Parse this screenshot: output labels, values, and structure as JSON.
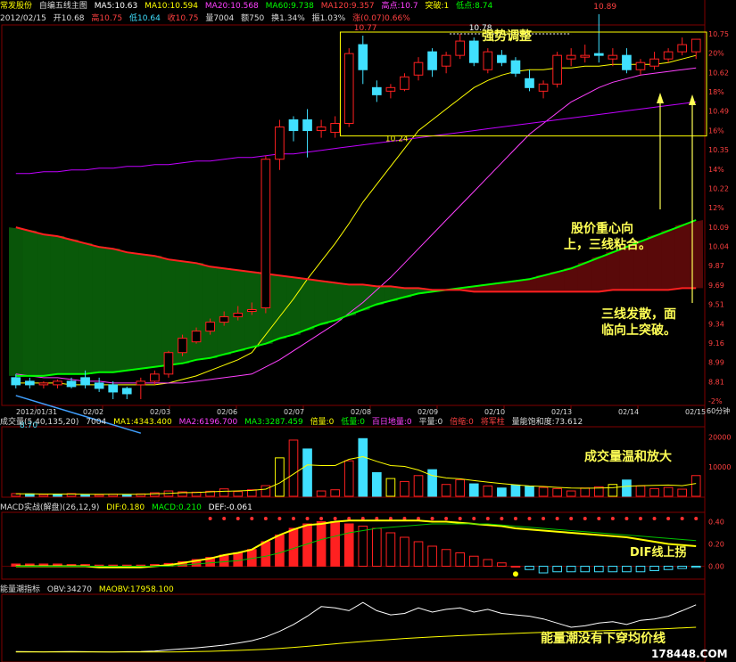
{
  "header": {
    "stock_name": "常发股份",
    "indicator_name": "自编五线主图",
    "ma5": "MA5:10.63",
    "ma10": "MA10:10.594",
    "ma20": "MA20:10.568",
    "ma60": "MA60:9.738",
    "ma120": "MA120:9.357",
    "high_point": "高点:10.7",
    "breakout": "突破:1",
    "low_point": "低点:8.74",
    "date": "2012/02/15",
    "open": "开10.68",
    "high": "高10.75",
    "low": "低10.64",
    "close": "收10.75",
    "volume": "量7004",
    "amount": "额750",
    "turnover": "换1.34%",
    "amplitude": "振1.03%",
    "change": "涨(0.07)0.66%"
  },
  "annotations": {
    "title": "强势调整",
    "gravity": [
      "股价重心向",
      "上，三线粘合。"
    ],
    "diverge": [
      "三线发散，面",
      "临向上突破。"
    ],
    "volume_note": "成交量温和放大",
    "dif_note": "DIF线上拐",
    "obv_note": "能量潮没有下穿均价线",
    "label_1077": "10.77",
    "label_1078": "10.78",
    "label_1089": "10.89",
    "label_1024": "10.24",
    "label_870": "8.70"
  },
  "price_axis": [
    "10.75",
    "20%",
    "10.62",
    "18%",
    "10.49",
    "16%",
    "10.35",
    "14%",
    "10.22",
    "12%",
    "10.09",
    "10.04",
    "9.87",
    "9.69",
    "9.51",
    "9.34",
    "9.16",
    "8.99",
    "8.81",
    "-2%"
  ],
  "date_axis": [
    "2012/01/31",
    "02/02",
    "02/03",
    "02/06",
    "02/07",
    "02/08",
    "02/09",
    "02/10",
    "02/13",
    "02/14",
    "02/15"
  ],
  "timeframe": "60分钟",
  "volume_header": {
    "name": "成交量(5,40,135,20)",
    "v": "7004",
    "ma1": "MA1:4343.400",
    "ma2": "MA2:6196.700",
    "ma3": "MA3:3287.459",
    "bei": "倍量:0",
    "di": "低量:0",
    "bairi": "百日地量:0",
    "ping": "平量:0",
    "beisuo": "倍缩:0",
    "jiangjun": "将军柱",
    "baohe": "量能饱和度:73.612"
  },
  "volume_axis": [
    "20000",
    "10000"
  ],
  "macd_header": {
    "name": "MACD实战(解盘)(26,12,9)",
    "dif": "DIF:0.180",
    "macd": "MACD:0.210",
    "dea": "DEF:-0.061"
  },
  "macd_axis": [
    "0.40",
    "0.20",
    "0.00"
  ],
  "obv_header": {
    "name": "能量潮指标",
    "obv": "OBV:34270",
    "maobv": "MAOBV:17958.100"
  },
  "watermark": "178448.COM",
  "colors": {
    "up": "#ff2020",
    "down": "#40e0ff",
    "ma5": "#ffffff",
    "ma10": "#ffff00",
    "ma20": "#ff40ff",
    "ma60": "#00ff00",
    "ma120": "#ff2020",
    "ma_long": "#c000ff"
  },
  "chart_data": [
    {
      "type": "candlestick",
      "title": "",
      "ylim": [
        8.72,
        10.82
      ],
      "annotations_price": {
        "high1": 10.77,
        "high2": 10.78,
        "high3": 10.89,
        "low1": 10.24,
        "low2": 8.7
      },
      "candles": [
        {
          "o": 8.86,
          "h": 8.88,
          "l": 8.8,
          "c": 8.82
        },
        {
          "o": 8.84,
          "h": 8.86,
          "l": 8.8,
          "c": 8.82
        },
        {
          "o": 8.82,
          "h": 8.84,
          "l": 8.8,
          "c": 8.83
        },
        {
          "o": 8.82,
          "h": 8.85,
          "l": 8.8,
          "c": 8.84
        },
        {
          "o": 8.84,
          "h": 8.86,
          "l": 8.8,
          "c": 8.81
        },
        {
          "o": 8.86,
          "h": 8.9,
          "l": 8.8,
          "c": 8.82
        },
        {
          "o": 8.83,
          "h": 8.86,
          "l": 8.78,
          "c": 8.8
        },
        {
          "o": 8.82,
          "h": 8.84,
          "l": 8.74,
          "c": 8.78
        },
        {
          "o": 8.8,
          "h": 8.81,
          "l": 8.74,
          "c": 8.77
        },
        {
          "o": 8.82,
          "h": 8.86,
          "l": 8.74,
          "c": 8.84
        },
        {
          "o": 8.84,
          "h": 8.9,
          "l": 8.82,
          "c": 8.88
        },
        {
          "o": 8.88,
          "h": 9.01,
          "l": 8.86,
          "c": 9.0
        },
        {
          "o": 9.0,
          "h": 9.1,
          "l": 8.98,
          "c": 9.08
        },
        {
          "o": 9.06,
          "h": 9.14,
          "l": 9.05,
          "c": 9.12
        },
        {
          "o": 9.12,
          "h": 9.19,
          "l": 9.1,
          "c": 9.17
        },
        {
          "o": 9.17,
          "h": 9.23,
          "l": 9.15,
          "c": 9.2
        },
        {
          "o": 9.2,
          "h": 9.26,
          "l": 9.18,
          "c": 9.22
        },
        {
          "o": 9.23,
          "h": 9.28,
          "l": 9.21,
          "c": 9.24
        },
        {
          "o": 9.25,
          "h": 10.1,
          "l": 9.22,
          "c": 10.08
        },
        {
          "o": 10.08,
          "h": 10.3,
          "l": 10.02,
          "c": 10.26
        },
        {
          "o": 10.3,
          "h": 10.32,
          "l": 10.18,
          "c": 10.24
        },
        {
          "o": 10.3,
          "h": 10.36,
          "l": 10.09,
          "c": 10.24
        },
        {
          "o": 10.24,
          "h": 10.3,
          "l": 10.2,
          "c": 10.26
        },
        {
          "o": 10.23,
          "h": 10.32,
          "l": 10.2,
          "c": 10.28
        },
        {
          "o": 10.28,
          "h": 10.7,
          "l": 10.26,
          "c": 10.67
        },
        {
          "o": 10.72,
          "h": 10.77,
          "l": 10.5,
          "c": 10.58
        },
        {
          "o": 10.48,
          "h": 10.52,
          "l": 10.4,
          "c": 10.44
        },
        {
          "o": 10.46,
          "h": 10.5,
          "l": 10.42,
          "c": 10.48
        },
        {
          "o": 10.47,
          "h": 10.56,
          "l": 10.46,
          "c": 10.54
        },
        {
          "o": 10.55,
          "h": 10.65,
          "l": 10.52,
          "c": 10.62
        },
        {
          "o": 10.68,
          "h": 10.7,
          "l": 10.54,
          "c": 10.58
        },
        {
          "o": 10.6,
          "h": 10.68,
          "l": 10.56,
          "c": 10.66
        },
        {
          "o": 10.66,
          "h": 10.78,
          "l": 10.64,
          "c": 10.74
        },
        {
          "o": 10.74,
          "h": 10.76,
          "l": 10.6,
          "c": 10.62
        },
        {
          "o": 10.58,
          "h": 10.7,
          "l": 10.56,
          "c": 10.68
        },
        {
          "o": 10.66,
          "h": 10.69,
          "l": 10.6,
          "c": 10.62
        },
        {
          "o": 10.63,
          "h": 10.65,
          "l": 10.54,
          "c": 10.56
        },
        {
          "o": 10.53,
          "h": 10.58,
          "l": 10.46,
          "c": 10.48
        },
        {
          "o": 10.46,
          "h": 10.52,
          "l": 10.42,
          "c": 10.5
        },
        {
          "o": 10.5,
          "h": 10.68,
          "l": 10.48,
          "c": 10.66
        },
        {
          "o": 10.64,
          "h": 10.7,
          "l": 10.6,
          "c": 10.66
        },
        {
          "o": 10.65,
          "h": 10.72,
          "l": 10.62,
          "c": 10.66
        },
        {
          "o": 10.67,
          "h": 10.89,
          "l": 10.62,
          "c": 10.66
        },
        {
          "o": 10.64,
          "h": 10.7,
          "l": 10.6,
          "c": 10.66
        },
        {
          "o": 10.66,
          "h": 10.7,
          "l": 10.56,
          "c": 10.58
        },
        {
          "o": 10.58,
          "h": 10.64,
          "l": 10.55,
          "c": 10.62
        },
        {
          "o": 10.6,
          "h": 10.68,
          "l": 10.58,
          "c": 10.64
        },
        {
          "o": 10.64,
          "h": 10.7,
          "l": 10.62,
          "c": 10.68
        },
        {
          "o": 10.68,
          "h": 10.76,
          "l": 10.66,
          "c": 10.72
        },
        {
          "o": 10.68,
          "h": 10.75,
          "l": 10.64,
          "c": 10.75
        }
      ],
      "series": [
        {
          "key": "ma10",
          "values": [
            8.83,
            8.83,
            8.83,
            8.83,
            8.82,
            8.82,
            8.82,
            8.82,
            8.82,
            8.82,
            8.82,
            8.83,
            8.85,
            8.87,
            8.9,
            8.93,
            8.96,
            9.0,
            9.1,
            9.2,
            9.3,
            9.41,
            9.51,
            9.61,
            9.72,
            9.84,
            9.94,
            10.04,
            10.14,
            10.24,
            10.3,
            10.36,
            10.42,
            10.48,
            10.52,
            10.55,
            10.57,
            10.58,
            10.58,
            10.59,
            10.59,
            10.6,
            10.6,
            10.61,
            10.61,
            10.61,
            10.61,
            10.62,
            10.64,
            10.66
          ]
        },
        {
          "key": "ma20",
          "values": [
            8.88,
            8.87,
            8.86,
            8.86,
            8.85,
            8.84,
            8.84,
            8.83,
            8.83,
            8.83,
            8.83,
            8.83,
            8.83,
            8.84,
            8.85,
            8.86,
            8.87,
            8.88,
            8.92,
            8.96,
            9.01,
            9.06,
            9.11,
            9.16,
            9.22,
            9.28,
            9.35,
            9.42,
            9.5,
            9.58,
            9.66,
            9.74,
            9.82,
            9.9,
            9.98,
            10.06,
            10.14,
            10.22,
            10.28,
            10.34,
            10.4,
            10.44,
            10.48,
            10.51,
            10.53,
            10.55,
            10.56,
            10.57,
            10.58,
            10.59
          ]
        },
        {
          "key": "ma_long",
          "values": [
            10.0,
            10.0,
            10.01,
            10.01,
            10.02,
            10.02,
            10.03,
            10.03,
            10.04,
            10.04,
            10.05,
            10.05,
            10.06,
            10.07,
            10.07,
            10.08,
            10.09,
            10.09,
            10.1,
            10.11,
            10.11,
            10.12,
            10.13,
            10.14,
            10.15,
            10.16,
            10.17,
            10.18,
            10.19,
            10.2,
            10.21,
            10.22,
            10.23,
            10.24,
            10.25,
            10.26,
            10.27,
            10.28,
            10.29,
            10.3,
            10.31,
            10.32,
            10.33,
            10.34,
            10.35,
            10.36,
            10.37,
            10.38,
            10.39,
            10.4
          ]
        },
        {
          "key": "ma60",
          "values": [
            8.87,
            8.87,
            8.87,
            8.88,
            8.88,
            8.88,
            8.89,
            8.89,
            8.9,
            8.91,
            8.92,
            8.93,
            8.94,
            8.96,
            8.97,
            8.99,
            9.01,
            9.03,
            9.05,
            9.08,
            9.1,
            9.13,
            9.16,
            9.18,
            9.21,
            9.24,
            9.27,
            9.29,
            9.31,
            9.33,
            9.34,
            9.35,
            9.36,
            9.37,
            9.38,
            9.39,
            9.4,
            9.41,
            9.43,
            9.45,
            9.47,
            9.5,
            9.53,
            9.56,
            9.59,
            9.62,
            9.65,
            9.68,
            9.71,
            9.74
          ]
        },
        {
          "key": "ma120",
          "values": [
            9.7,
            9.68,
            9.66,
            9.65,
            9.63,
            9.61,
            9.59,
            9.58,
            9.56,
            9.55,
            9.54,
            9.52,
            9.51,
            9.5,
            9.48,
            9.47,
            9.46,
            9.45,
            9.44,
            9.43,
            9.42,
            9.41,
            9.4,
            9.39,
            9.38,
            9.38,
            9.37,
            9.37,
            9.36,
            9.36,
            9.35,
            9.35,
            9.35,
            9.34,
            9.34,
            9.34,
            9.34,
            9.34,
            9.34,
            9.34,
            9.34,
            9.34,
            9.34,
            9.35,
            9.35,
            9.35,
            9.35,
            9.35,
            9.36,
            9.36
          ]
        }
      ]
    },
    {
      "type": "bar",
      "title": "成交量",
      "ylim": [
        0,
        22000
      ],
      "values": [
        900,
        800,
        600,
        700,
        900,
        600,
        500,
        700,
        600,
        800,
        1200,
        1800,
        1500,
        1400,
        1700,
        2500,
        1600,
        2200,
        3600,
        13000,
        19000,
        16000,
        1800,
        2200,
        12000,
        19500,
        8000,
        6000,
        5000,
        7000,
        9000,
        4000,
        5600,
        4200,
        3500,
        2800,
        3800,
        3400,
        3000,
        2600,
        1800,
        2800,
        3200,
        4000,
        5500,
        3500,
        2600,
        3000,
        2400,
        7004
      ],
      "up": [
        1,
        0,
        1,
        0,
        1,
        0,
        1,
        1,
        0,
        1,
        1,
        1,
        1,
        1,
        1,
        1,
        1,
        1,
        1,
        1,
        1,
        0,
        1,
        1,
        1,
        0,
        0,
        1,
        1,
        1,
        0,
        1,
        1,
        0,
        1,
        0,
        0,
        0,
        1,
        1,
        1,
        1,
        1,
        1,
        0,
        1,
        1,
        1,
        1,
        1
      ],
      "ma_line": [
        800,
        800,
        750,
        750,
        750,
        700,
        700,
        700,
        650,
        700,
        800,
        1000,
        1200,
        1300,
        1500,
        1700,
        1800,
        2000,
        2400,
        4500,
        7500,
        10600,
        10400,
        10400,
        12500,
        13400,
        11800,
        10400,
        10100,
        8900,
        7000,
        6200,
        5900,
        5300,
        4800,
        4300,
        3900,
        3500,
        3300,
        3000,
        2800,
        2700,
        2800,
        2900,
        3400,
        3600,
        3700,
        3800,
        3600,
        4343
      ]
    },
    {
      "type": "bar",
      "title": "MACD",
      "ylim": [
        -0.1,
        0.46
      ],
      "values": [
        0.02,
        0.02,
        0.02,
        0.02,
        0.015,
        0.015,
        0.01,
        0.01,
        0.01,
        0.01,
        0.015,
        0.025,
        0.04,
        0.06,
        0.08,
        0.1,
        0.12,
        0.15,
        0.22,
        0.28,
        0.34,
        0.38,
        0.4,
        0.4,
        0.38,
        0.36,
        0.34,
        0.3,
        0.26,
        0.22,
        0.18,
        0.15,
        0.12,
        0.09,
        0.06,
        0.03,
        0.0,
        -0.03,
        -0.06,
        -0.05,
        -0.05,
        -0.05,
        -0.05,
        -0.05,
        -0.05,
        -0.05,
        -0.04,
        -0.03,
        -0.02,
        -0.01
      ],
      "dif": [
        0.0,
        0.0,
        0.0,
        0.0,
        0.0,
        0.0,
        -0.01,
        -0.01,
        -0.01,
        -0.01,
        0.0,
        0.01,
        0.03,
        0.05,
        0.07,
        0.1,
        0.12,
        0.15,
        0.22,
        0.28,
        0.33,
        0.37,
        0.38,
        0.4,
        0.41,
        0.41,
        0.41,
        0.41,
        0.41,
        0.41,
        0.4,
        0.4,
        0.39,
        0.38,
        0.37,
        0.36,
        0.34,
        0.33,
        0.32,
        0.31,
        0.3,
        0.29,
        0.28,
        0.27,
        0.26,
        0.24,
        0.22,
        0.2,
        0.19,
        0.18
      ],
      "dea": [
        0.0,
        0.0,
        0.0,
        0.0,
        0.0,
        0.0,
        0.0,
        0.0,
        0.0,
        0.0,
        0.0,
        0.0,
        0.01,
        0.02,
        0.03,
        0.04,
        0.05,
        0.07,
        0.09,
        0.12,
        0.16,
        0.2,
        0.24,
        0.27,
        0.3,
        0.32,
        0.34,
        0.35,
        0.36,
        0.37,
        0.38,
        0.38,
        0.38,
        0.38,
        0.38,
        0.37,
        0.36,
        0.35,
        0.34,
        0.33,
        0.32,
        0.31,
        0.3,
        0.29,
        0.28,
        0.27,
        0.26,
        0.25,
        0.24,
        0.23
      ]
    },
    {
      "type": "line",
      "title": "能量潮指标",
      "ylim": [
        -6000,
        40000
      ],
      "series": [
        {
          "key": "obv",
          "values": [
            300,
            200,
            100,
            200,
            300,
            200,
            100,
            0,
            200,
            300,
            700,
            1500,
            2200,
            3000,
            4000,
            5000,
            6500,
            8200,
            11000,
            15000,
            20000,
            26000,
            33000,
            32000,
            30000,
            36000,
            30000,
            27000,
            28000,
            32000,
            29000,
            31000,
            32000,
            29000,
            31000,
            28000,
            27000,
            26000,
            24000,
            21000,
            18000,
            19000,
            21000,
            22000,
            20000,
            23000,
            24000,
            26000,
            30000,
            34270
          ]
        },
        {
          "key": "maobv",
          "values": [
            0,
            0,
            0,
            0,
            0,
            0,
            0,
            0,
            0,
            0,
            0,
            0,
            100,
            300,
            500,
            800,
            1100,
            1500,
            2000,
            2600,
            3300,
            4100,
            5000,
            5900,
            6800,
            7600,
            8400,
            9100,
            9800,
            10400,
            10900,
            11400,
            11900,
            12300,
            12700,
            13100,
            13500,
            13900,
            14200,
            14500,
            14800,
            15100,
            15400,
            15700,
            16000,
            16300,
            16600,
            17000,
            17500,
            17958
          ]
        }
      ]
    }
  ]
}
